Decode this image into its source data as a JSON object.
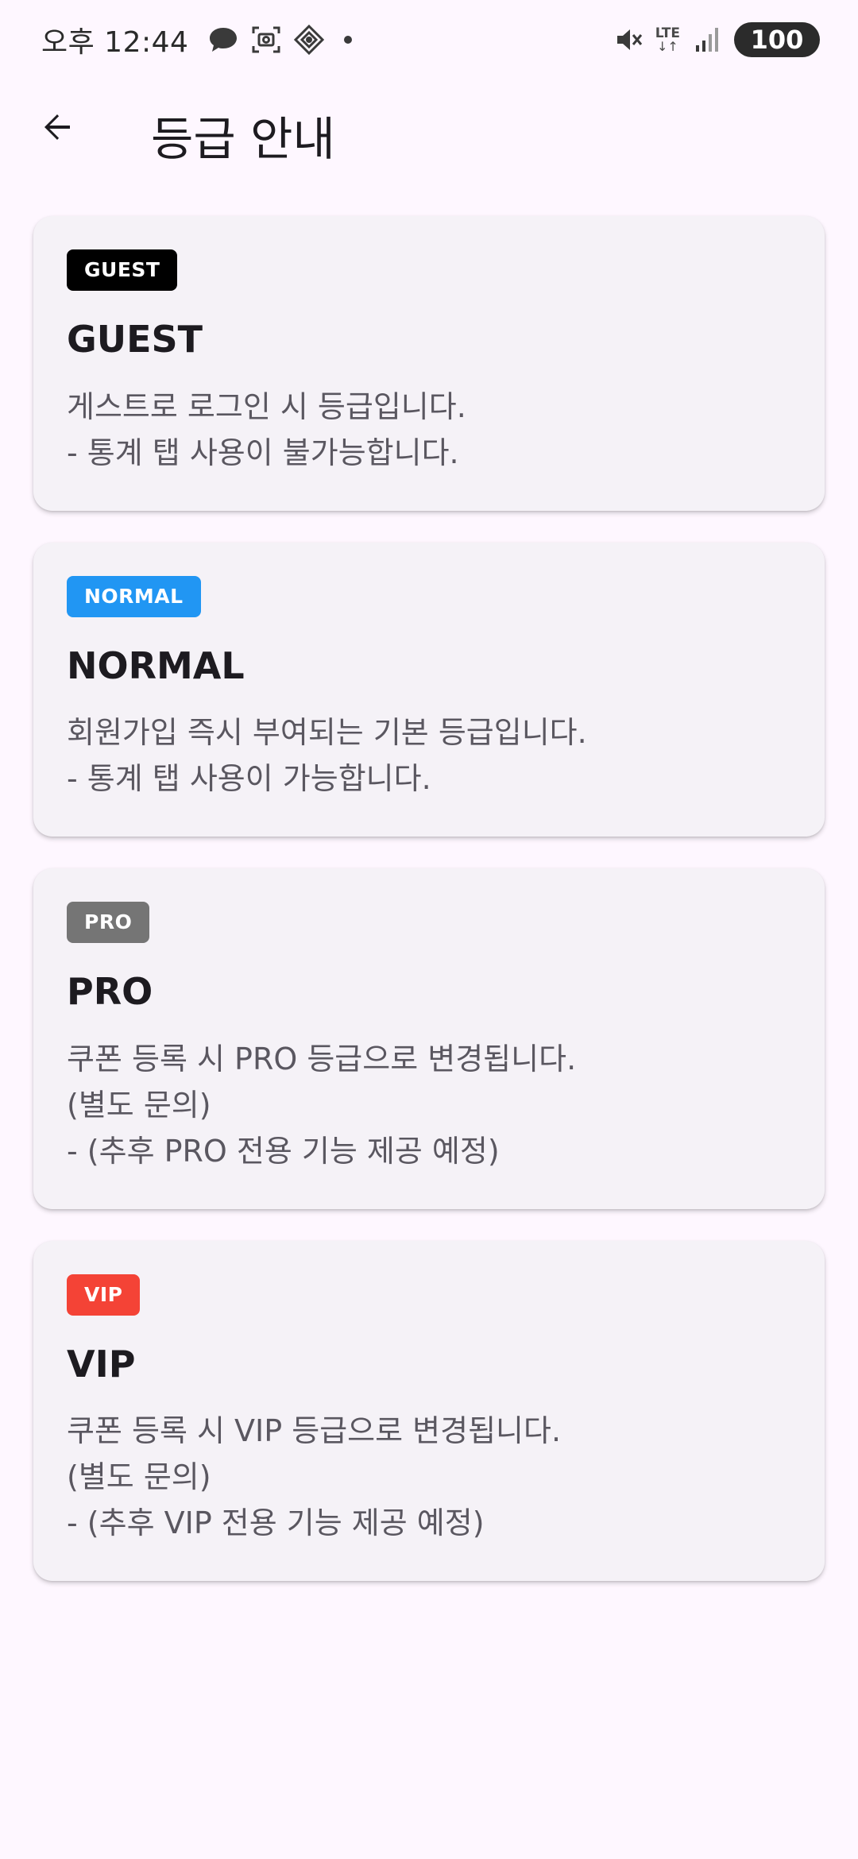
{
  "status_bar": {
    "time": "오후 12:44",
    "battery": "100",
    "network": "LTE"
  },
  "app_bar": {
    "title": "등급 안내",
    "back_icon": "arrow-back-icon"
  },
  "grades": [
    {
      "badge": "GUEST",
      "badge_color": "#000000",
      "title": "GUEST",
      "lines": [
        "게스트로 로그인 시 등급입니다.",
        "- 통계 탭 사용이 불가능합니다."
      ]
    },
    {
      "badge": "NORMAL",
      "badge_color": "#2196F3",
      "title": "NORMAL",
      "lines": [
        "회원가입 즉시 부여되는 기본 등급입니다.",
        "- 통계 탭 사용이 가능합니다."
      ]
    },
    {
      "badge": "PRO",
      "badge_color": "#757575",
      "title": "PRO",
      "lines": [
        "쿠폰 등록 시 PRO 등급으로 변경됩니다.",
        "(별도 문의)",
        "- (추후 PRO 전용 기능 제공 예정)"
      ]
    },
    {
      "badge": "VIP",
      "badge_color": "#F44336",
      "title": "VIP",
      "lines": [
        "쿠폰 등록 시 VIP 등급으로 변경됩니다.",
        "(별도 문의)",
        "- (추후 VIP 전용 기능 제공 예정)"
      ]
    }
  ]
}
